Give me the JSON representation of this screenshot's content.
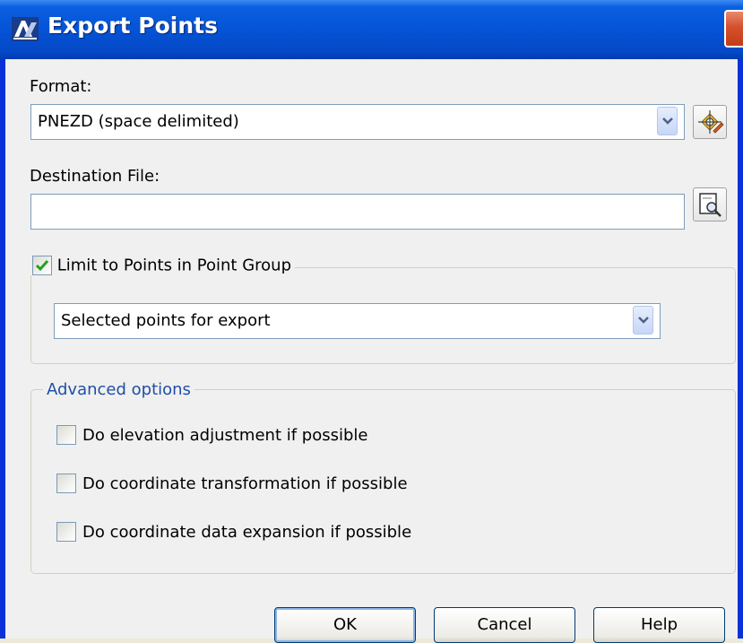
{
  "window": {
    "title": "Export Points"
  },
  "format": {
    "label": "Format:",
    "selected": "PNEZD (space delimited)"
  },
  "destination": {
    "label": "Destination File:",
    "value": ""
  },
  "point_group": {
    "checkbox_label": "Limit to Points in Point Group",
    "checked": true,
    "selected": "Selected points for export"
  },
  "advanced": {
    "legend": "Advanced options",
    "options": [
      {
        "label": "Do elevation adjustment if possible",
        "checked": false
      },
      {
        "label": "Do coordinate transformation if possible",
        "checked": false
      },
      {
        "label": "Do coordinate data expansion if possible",
        "checked": false
      }
    ]
  },
  "buttons": {
    "ok": "OK",
    "cancel": "Cancel",
    "help": "Help"
  },
  "colors": {
    "title_bar": "#0553d6",
    "legend_text": "#1f4fa7",
    "check_mark": "#21a121",
    "close_button": "#d4502d"
  },
  "icons": {
    "app": "civil3d-app-icon",
    "format_edit": "format-edit-icon",
    "browse": "browse-file-icon",
    "close": "close-icon"
  }
}
